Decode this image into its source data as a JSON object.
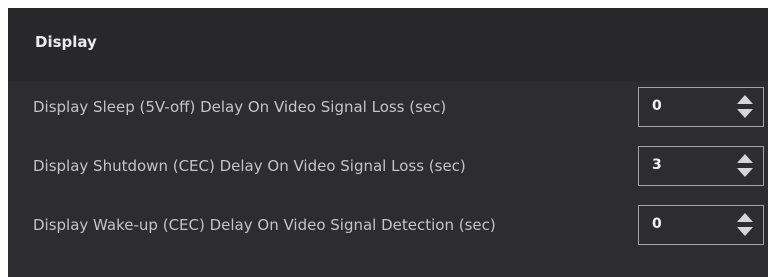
{
  "section": {
    "title": "Display"
  },
  "settings": [
    {
      "label": "Display Sleep (5V-off) Delay On Video Signal Loss (sec)",
      "value": "0"
    },
    {
      "label": "Display Shutdown (CEC) Delay On Video Signal Loss (sec)",
      "value": "3"
    },
    {
      "label": "Display Wake-up (CEC) Delay On Video Signal Detection (sec)",
      "value": "0"
    }
  ],
  "colors": {
    "panel_background": "#2d2d30",
    "header_background": "#28282b",
    "label_text": "#c4c4c6",
    "input_border": "#a3a3a6"
  },
  "icons": {
    "spinner_up": "arrow-up-icon",
    "spinner_down": "arrow-down-icon"
  }
}
